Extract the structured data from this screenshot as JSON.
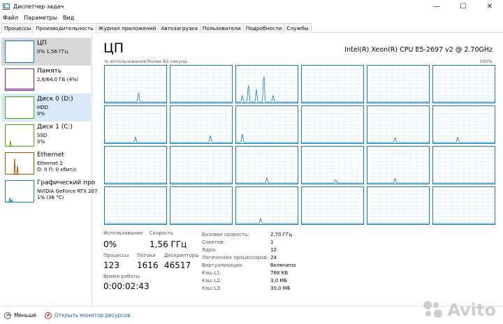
{
  "window": {
    "title": "Диспетчер задач",
    "min": "—",
    "max": "☐",
    "close": "✕"
  },
  "menu": [
    "Файл",
    "Параметры",
    "Вид"
  ],
  "tabs": [
    "Процессы",
    "Производительность",
    "Журнал приложений",
    "Автозагрузка",
    "Пользователи",
    "Подробности",
    "Службы"
  ],
  "active_tab": "Производительность",
  "sidebar": [
    {
      "name": "ЦП",
      "sub1": "0% 1,56 ГГц",
      "sub2": "",
      "color": "#117dbb"
    },
    {
      "name": "Память",
      "sub1": "2,8/64,0 ГБ (4%)",
      "sub2": "",
      "color": "#8b12ae"
    },
    {
      "name": "Диск 0 (D:)",
      "sub1": "HDD",
      "sub2": "0%",
      "color": "#4da60c"
    },
    {
      "name": "Диск 1 (C:)",
      "sub1": "SSD",
      "sub2": "0%",
      "color": "#4da60c"
    },
    {
      "name": "Ethernet",
      "sub1": "Ethernet 2",
      "sub2": "О: 0 П: 0 кбит/с",
      "color": "#a74f01"
    },
    {
      "name": "Графический про",
      "sub1": "NVIDIA GeForce RTX 207",
      "sub2": "1% (38 °C)",
      "color": "#117dbb"
    }
  ],
  "cpu": {
    "title": "ЦП",
    "model": "Intel(R) Xeon(R) CPU E5-2697 v2 @ 2.70GHz",
    "graph_caption": "% использования более 60 секунд",
    "graph_max": "100%",
    "core_count_shown": 24
  },
  "stats": {
    "usage_label": "Использование",
    "usage_value": "0%",
    "speed_label": "Скорость",
    "speed_value": "1,56 ГГц",
    "processes_label": "Процессы",
    "processes_value": "123",
    "threads_label": "Потоки",
    "threads_value": "1616",
    "handles_label": "Дескрипторы",
    "handles_value": "46517",
    "uptime_label": "Время работы",
    "uptime_value": "0:00:02:43"
  },
  "props": [
    {
      "label": "Базовая скорость:",
      "value": "2,70 ГГц"
    },
    {
      "label": "Сокетов:",
      "value": "1"
    },
    {
      "label": "Ядра:",
      "value": "12"
    },
    {
      "label": "Логических процессоров:",
      "value": "24"
    },
    {
      "label": "Виртуализация:",
      "value": "Включено"
    },
    {
      "label": "Кэш L1:",
      "value": "768 КБ"
    },
    {
      "label": "Кэш L2:",
      "value": "3,0 МБ"
    },
    {
      "label": "Кэш L3:",
      "value": "30,0 МБ"
    }
  ],
  "footer": {
    "less": "Меньше",
    "monitor": "Открыть монитор ресурсов"
  },
  "watermark": "Avito"
}
